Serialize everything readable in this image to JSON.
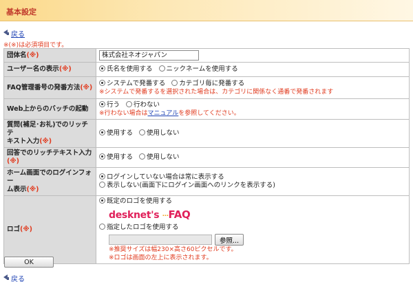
{
  "header": {
    "title": "基本設定"
  },
  "nav": {
    "back_label": "戻る"
  },
  "required_note": "※(※)は必須項目です。",
  "required_mark": "(※)",
  "rows": {
    "org_name": {
      "label": "団体名",
      "value": "株式会社ネオジャパン"
    },
    "user_name_display": {
      "label": "ユーザー名の表示",
      "options": [
        "氏名を使用する",
        "ニックネームを使用する"
      ]
    },
    "faq_numbering": {
      "label": "FAQ管理番号の発番方法",
      "options": [
        "システムで発番する",
        "カテゴリ毎に発番する"
      ],
      "note": "※システムで発番するを選択された場合は、カテゴリに関係なく通番で発番されます"
    },
    "web_batch": {
      "label": "Web上からのバッチの起動",
      "options": [
        "行う",
        "行わない"
      ],
      "note_before": "※行わない場合は",
      "note_link": "マニュアル",
      "note_after": "を参照してください。"
    },
    "question_richtext": {
      "label_1": "質問(補足･お礼)でのリッチテ",
      "label_2": "キスト入力",
      "options": [
        "使用する",
        "使用しない"
      ]
    },
    "answer_richtext": {
      "label": "回答でのリッチテキスト入力",
      "options": [
        "使用する",
        "使用しない"
      ]
    },
    "home_login_form": {
      "label_1": "ホーム画面でのログインフォー",
      "label_2": "ム表示",
      "options": [
        "ログインしていない場合は常に表示する",
        "表示しない(画面下にログイン画面へのリンクを表示する)"
      ]
    },
    "logo": {
      "label": "ロゴ",
      "option_default": "既定のロゴを使用する",
      "option_custom": "指定したロゴを使用する",
      "logo_text_main": "desknet's",
      "logo_text_sup": "…",
      "logo_text_faq": "FAQ",
      "browse_button": "参照...",
      "note_1": "※推奨サイズは幅230×高さ60ピクセルです。",
      "note_2": "※ロゴは画面の左上に表示されます。"
    }
  },
  "ok_button": "OK",
  "colors": {
    "required": "#e03a1e",
    "title": "#c0392b",
    "link": "#1a3fb3",
    "label_bg": "#dcdcdc"
  }
}
